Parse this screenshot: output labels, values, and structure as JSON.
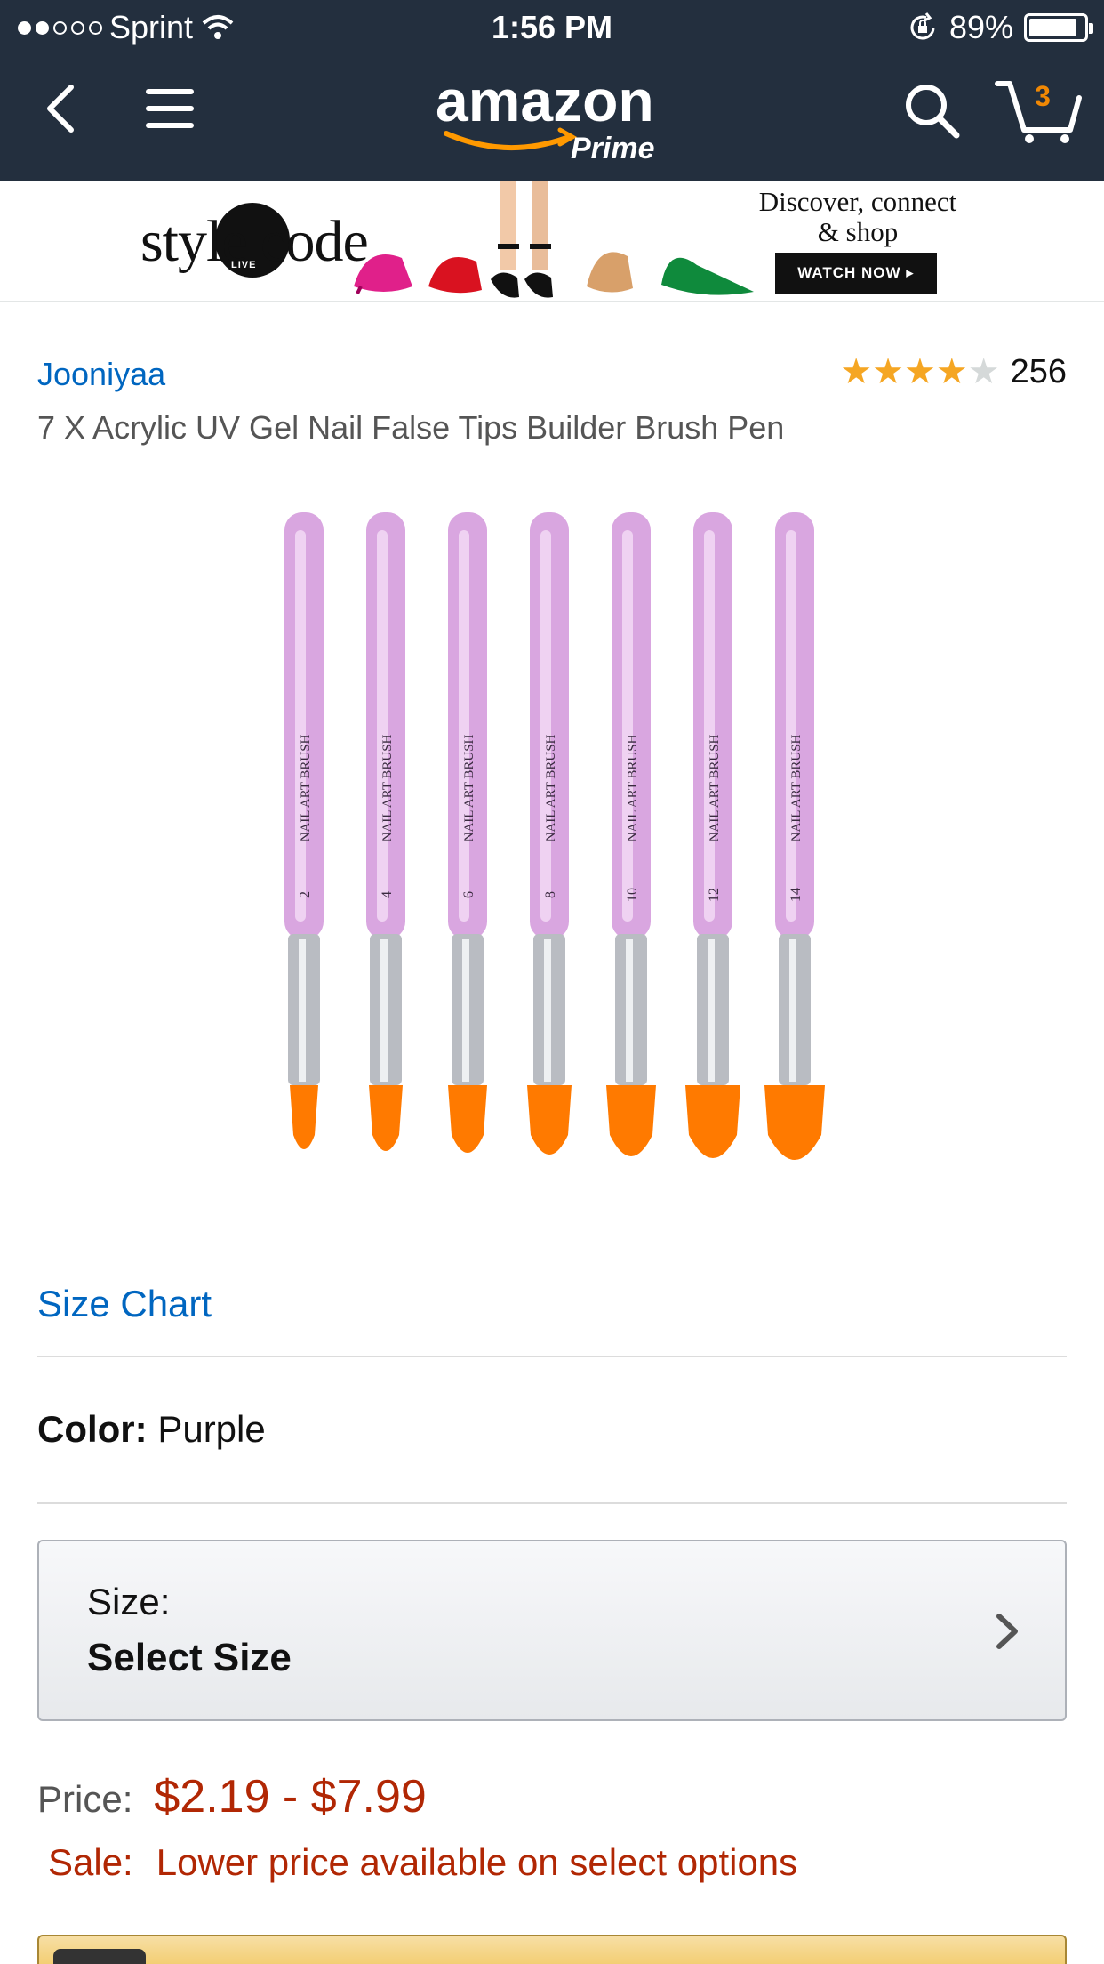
{
  "status_bar": {
    "carrier": "Sprint",
    "time": "1:56 PM",
    "battery": "89%",
    "battery_level": 0.89
  },
  "nav": {
    "logo_text": "amazon",
    "logo_sub": "Prime",
    "cart_count": "3",
    "icons": [
      "back-icon",
      "menu-icon",
      "search-icon",
      "cart-icon"
    ]
  },
  "ad": {
    "brand": "style code",
    "brand_badge": "LIVE",
    "tagline": "Discover, connect & shop",
    "cta": "WATCH NOW ▸"
  },
  "product": {
    "brand": "Jooniyaa",
    "rating": 4,
    "rating_max": 5,
    "review_count": "256",
    "title": "7 X Acrylic UV Gel Nail False Tips Builder Brush Pen",
    "brush_label": "NAIL ART BRUSH",
    "brush_sizes": [
      "2",
      "4",
      "6",
      "8",
      "10",
      "12",
      "14"
    ]
  },
  "size_chart": "Size Chart",
  "color": {
    "label": "Color:",
    "value": "Purple"
  },
  "size": {
    "label": "Size:",
    "value": "Select Size"
  },
  "price": {
    "label": "Price:",
    "value": "$2.19 - $7.99",
    "sale_label": "Sale:",
    "sale_text": "Lower price available on select options"
  },
  "colors": {
    "header_bg": "#232f3e",
    "link": "#0066c0",
    "price": "#b12704",
    "star": "#f5a623",
    "brush_handle": "#d9a6e0",
    "brush_tip": "#ff7a00"
  }
}
